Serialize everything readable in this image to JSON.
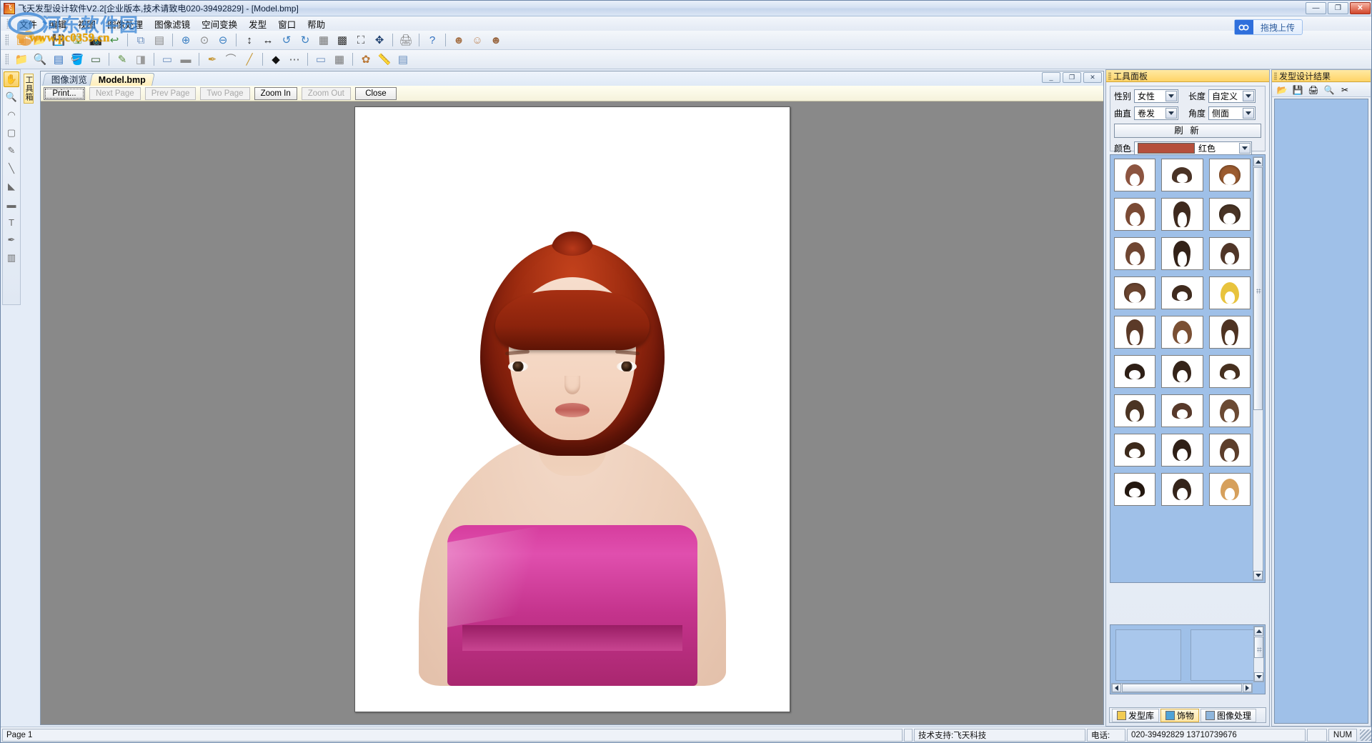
{
  "window": {
    "title": "飞天发型设计软件V2.2[企业版本,技术请致电020-39492829] - [Model.bmp]",
    "app_icon": "app-icon",
    "minimize": "—",
    "restore": "❐",
    "close": "✕"
  },
  "watermark": {
    "site_cn": "河东软件园",
    "site_url": "www.pc0359.cn"
  },
  "upload": {
    "label": "拖拽上传",
    "icon": "link-icon"
  },
  "menu": {
    "items": [
      {
        "label": "文件",
        "name": "menu-file"
      },
      {
        "label": "编辑",
        "name": "menu-edit"
      },
      {
        "label": "视图",
        "name": "menu-view"
      },
      {
        "label": "图像处理",
        "name": "menu-image-processing"
      },
      {
        "label": "图像滤镜",
        "name": "menu-image-filter"
      },
      {
        "label": "空间变换",
        "name": "menu-spatial-transform"
      },
      {
        "label": "发型",
        "name": "menu-hairstyle"
      },
      {
        "label": "窗口",
        "name": "menu-window"
      },
      {
        "label": "帮助",
        "name": "menu-help"
      }
    ]
  },
  "toolbar_row1": [
    {
      "name": "new-icon",
      "glyph": "▣",
      "color": "#e8a33d"
    },
    {
      "name": "open-icon",
      "glyph": "📂",
      "color": "#e0a83c"
    },
    {
      "name": "save-icon",
      "glyph": "💾",
      "color": "#4b6fae"
    },
    {
      "name": "save-as-icon",
      "glyph": "🖫",
      "color": "#6a9a4a"
    },
    {
      "name": "camera-icon",
      "glyph": "📷",
      "color": "#4c4c4c"
    },
    {
      "name": "undo-icon",
      "glyph": "↩",
      "color": "#3d8c3d"
    },
    {
      "sep": true
    },
    {
      "name": "copy-icon",
      "glyph": "⧉",
      "color": "#6d8fbe"
    },
    {
      "name": "paste-icon",
      "glyph": "▤",
      "color": "#8a8a8a"
    },
    {
      "sep": true
    },
    {
      "name": "zoom-in-icon",
      "glyph": "⊕",
      "color": "#3a7fc2"
    },
    {
      "name": "zoom-actual-icon",
      "glyph": "⊙",
      "color": "#8a8a8a"
    },
    {
      "name": "zoom-out-icon",
      "glyph": "⊖",
      "color": "#3a7fc2"
    },
    {
      "sep": true
    },
    {
      "name": "flip-vertical-icon",
      "glyph": "↕",
      "color": "#222"
    },
    {
      "name": "flip-horizontal-icon",
      "glyph": "↔",
      "color": "#222"
    },
    {
      "name": "rotate-left-icon",
      "glyph": "↺",
      "color": "#3a7fc2"
    },
    {
      "name": "rotate-right-icon",
      "glyph": "↻",
      "color": "#3a7fc2"
    },
    {
      "name": "select-all-icon",
      "glyph": "▦",
      "color": "#777"
    },
    {
      "name": "invert-select-icon",
      "glyph": "▩",
      "color": "#333"
    },
    {
      "name": "crop-icon",
      "glyph": "⛶",
      "color": "#444"
    },
    {
      "name": "move-icon",
      "glyph": "✥",
      "color": "#1d3f6e"
    },
    {
      "sep": true
    },
    {
      "name": "print-icon",
      "glyph": "🖨",
      "color": "#7f7f7f"
    },
    {
      "sep": true
    },
    {
      "name": "help-icon",
      "glyph": "?",
      "color": "#2f6fbf"
    },
    {
      "sep": true
    },
    {
      "name": "face-thumb-icon",
      "glyph": "☻",
      "color": "#a8774f"
    },
    {
      "name": "portrait-thumb-icon",
      "glyph": "☺",
      "color": "#c08a5e"
    },
    {
      "name": "model-thumb-icon",
      "glyph": "☻",
      "color": "#9b6a45"
    }
  ],
  "toolbar_row2": [
    {
      "name": "open-folder-icon",
      "glyph": "📁",
      "color": "#e0a83c"
    },
    {
      "name": "magnify-icon",
      "glyph": "🔍",
      "color": "#8c6a3a"
    },
    {
      "name": "color-picker-icon",
      "glyph": "▤",
      "color": "#2f6fbf"
    },
    {
      "name": "fill-icon",
      "glyph": "🪣",
      "color": "#6a9a4a"
    },
    {
      "name": "stamp-icon",
      "glyph": "▭",
      "color": "#3b5e3b"
    },
    {
      "sep": true
    },
    {
      "name": "brush-icon",
      "glyph": "✎",
      "color": "#5a8f3b"
    },
    {
      "name": "eraser-icon",
      "glyph": "◨",
      "color": "#9a9a9a"
    },
    {
      "sep": true
    },
    {
      "name": "shape-rect-icon",
      "glyph": "▭",
      "color": "#6d8fbe"
    },
    {
      "name": "shape-fill-icon",
      "glyph": "▬",
      "color": "#8a8a8a"
    },
    {
      "sep": true
    },
    {
      "name": "pen-icon",
      "glyph": "✒",
      "color": "#c79a3d"
    },
    {
      "name": "curve-icon",
      "glyph": "⌒",
      "color": "#8a8a8a"
    },
    {
      "name": "line-icon",
      "glyph": "╱",
      "color": "#c79a3d"
    },
    {
      "sep": true
    },
    {
      "name": "arrow-icon",
      "glyph": "◆",
      "color": "#111"
    },
    {
      "name": "dots-icon",
      "glyph": "⋯",
      "color": "#555"
    },
    {
      "sep": true
    },
    {
      "name": "panel-icon",
      "glyph": "▭",
      "color": "#6d8fbe"
    },
    {
      "name": "grid-icon",
      "glyph": "▦",
      "color": "#777"
    },
    {
      "sep": true
    },
    {
      "name": "effects-icon",
      "glyph": "✿",
      "color": "#bb7a3a"
    },
    {
      "name": "measure-icon",
      "glyph": "📏",
      "color": "#7a7a7a"
    },
    {
      "name": "layers-icon",
      "glyph": "▤",
      "color": "#6a8fbe"
    }
  ],
  "tool_palette": [
    {
      "name": "hand-tool",
      "glyph": "✋",
      "active": true
    },
    {
      "name": "zoom-tool",
      "glyph": "🔍",
      "active": false
    },
    {
      "name": "lasso-tool",
      "glyph": "◠",
      "active": false
    },
    {
      "name": "marquee-tool",
      "glyph": "▢",
      "active": false
    },
    {
      "name": "pencil-tool",
      "glyph": "✎",
      "active": false
    },
    {
      "name": "line-tool",
      "glyph": "╲",
      "active": false
    },
    {
      "name": "polygon-tool",
      "glyph": "◣",
      "active": false
    },
    {
      "name": "rectangle-tool",
      "glyph": "▬",
      "active": false
    },
    {
      "name": "text-tool",
      "glyph": "T",
      "active": false
    },
    {
      "name": "eyedropper-tool",
      "glyph": "✒",
      "active": false
    },
    {
      "name": "chart-tool",
      "glyph": "▥",
      "active": false
    }
  ],
  "tool_palette_label": "工具箱",
  "mdi": {
    "tabs": [
      {
        "label": "图像浏览",
        "name": "tab-image-browse",
        "active": false
      },
      {
        "label": "Model.bmp",
        "name": "tab-model-bmp",
        "active": true
      }
    ],
    "window_controls": {
      "minimize": "_",
      "restore": "❐",
      "close": "✕"
    },
    "child_nav": {
      "prev": "◄",
      "next": "►",
      "close": "✕"
    }
  },
  "print_preview": {
    "buttons": [
      {
        "label": "Print...",
        "name": "print-button",
        "disabled": false,
        "focus": true,
        "accel": "P"
      },
      {
        "label": "Next Page",
        "name": "next-page-button",
        "disabled": true,
        "accel": "N"
      },
      {
        "label": "Prev Page",
        "name": "prev-page-button",
        "disabled": true,
        "accel": "v"
      },
      {
        "label": "Two Page",
        "name": "two-page-button",
        "disabled": true,
        "accel": "T"
      },
      {
        "label": "Zoom In",
        "name": "zoom-in-button",
        "disabled": false,
        "accel": "I"
      },
      {
        "label": "Zoom Out",
        "name": "zoom-out-button",
        "disabled": true,
        "accel": "O"
      },
      {
        "label": "Close",
        "name": "close-button",
        "disabled": false,
        "accel": "C"
      }
    ]
  },
  "tool_panel": {
    "caption": "工具面板",
    "fields": {
      "gender_label": "性别",
      "gender_value": "女性",
      "length_label": "长度",
      "length_value": "自定义",
      "curl_label": "曲直",
      "curl_value": "卷发",
      "angle_label": "角度",
      "angle_value": "侧面",
      "refresh_label": "刷 新",
      "color_label": "颜色",
      "color_value": "红色",
      "color_hex": "#b5503c"
    },
    "thumbnails": [
      {
        "name": "hairstyle-thumb",
        "color": "#8c5440",
        "shape": "bob"
      },
      {
        "name": "hairstyle-thumb",
        "color": "#4a3326",
        "shape": "short"
      },
      {
        "name": "hairstyle-thumb",
        "color": "#9c5c30",
        "shape": "curly"
      },
      {
        "name": "hairstyle-thumb",
        "color": "#7a4a34",
        "shape": "wavy"
      },
      {
        "name": "hairstyle-thumb",
        "color": "#3f2a1e",
        "shape": "long"
      },
      {
        "name": "hairstyle-thumb",
        "color": "#4a3526",
        "shape": "curly"
      },
      {
        "name": "hairstyle-thumb",
        "color": "#6f4632",
        "shape": "wavy"
      },
      {
        "name": "hairstyle-thumb",
        "color": "#332218",
        "shape": "long"
      },
      {
        "name": "hairstyle-thumb",
        "color": "#503628",
        "shape": "bob"
      },
      {
        "name": "hairstyle-thumb",
        "color": "#6b4530",
        "shape": "curly"
      },
      {
        "name": "hairstyle-thumb",
        "color": "#402b1e",
        "shape": "short"
      },
      {
        "name": "hairstyle-thumb",
        "color": "#e8c33d",
        "shape": "blonde"
      },
      {
        "name": "hairstyle-thumb",
        "color": "#5b3a28",
        "shape": "long"
      },
      {
        "name": "hairstyle-thumb",
        "color": "#7a4f33",
        "shape": "wavy"
      },
      {
        "name": "hairstyle-thumb",
        "color": "#4e3322",
        "shape": "long"
      },
      {
        "name": "hairstyle-thumb",
        "color": "#2e1f16",
        "shape": "short"
      },
      {
        "name": "hairstyle-thumb",
        "color": "#352419",
        "shape": "bob"
      },
      {
        "name": "hairstyle-thumb",
        "color": "#46301f",
        "shape": "short"
      },
      {
        "name": "hairstyle-thumb",
        "color": "#4b3423",
        "shape": "bob"
      },
      {
        "name": "hairstyle-thumb",
        "color": "#57392a",
        "shape": "short"
      },
      {
        "name": "hairstyle-thumb",
        "color": "#6b4a33",
        "shape": "wavy"
      },
      {
        "name": "hairstyle-thumb",
        "color": "#3d2a1c",
        "shape": "short"
      },
      {
        "name": "hairstyle-thumb",
        "color": "#2f2017",
        "shape": "bob"
      },
      {
        "name": "hairstyle-thumb",
        "color": "#5c3e2b",
        "shape": "wavy"
      },
      {
        "name": "hairstyle-thumb",
        "color": "#241810",
        "shape": "short"
      },
      {
        "name": "hairstyle-thumb",
        "color": "#34241a",
        "shape": "bob"
      },
      {
        "name": "hairstyle-thumb",
        "color": "#d6a05c",
        "shape": "blonde"
      }
    ],
    "tabs": [
      {
        "label": "发型库",
        "name": "tab-hairstyle-library",
        "active": false,
        "icon": "person-icon"
      },
      {
        "label": "饰物",
        "name": "tab-accessories",
        "active": true,
        "icon": "palette-icon"
      },
      {
        "label": "图像处理",
        "name": "tab-image-processing",
        "active": false,
        "icon": "image-icon"
      }
    ]
  },
  "result_panel": {
    "caption": "发型设计结果",
    "toolbar": [
      {
        "name": "open-result-icon",
        "glyph": "📂"
      },
      {
        "name": "save-result-icon",
        "glyph": "💾"
      },
      {
        "name": "print-result-icon",
        "glyph": "🖨"
      },
      {
        "name": "preview-result-icon",
        "glyph": "🔍"
      },
      {
        "name": "cut-result-icon",
        "glyph": "✂"
      }
    ]
  },
  "statusbar": {
    "page": "Page 1",
    "support_label": "技术支持:飞天科技",
    "phone_label": "电话:",
    "phone_value": "020-39492829 13710739676",
    "num_lock": "NUM"
  }
}
